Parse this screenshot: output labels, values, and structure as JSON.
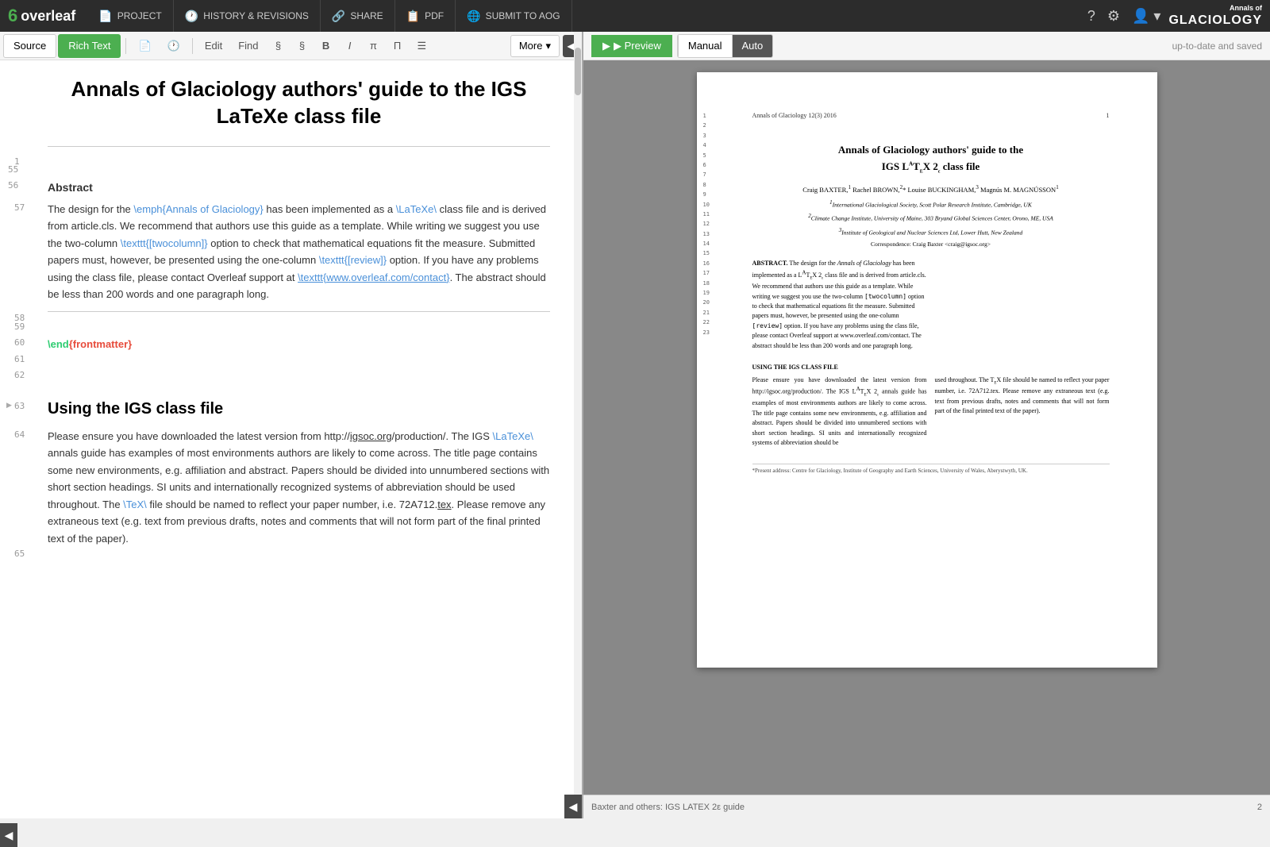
{
  "app": {
    "brand": "overleaf",
    "brand_icon": "6"
  },
  "top_nav": {
    "items": [
      {
        "id": "project",
        "icon": "📄",
        "label": "PROJECT"
      },
      {
        "id": "history",
        "icon": "🕐",
        "label": "HISTORY & REVISIONS"
      },
      {
        "id": "share",
        "icon": "🔗",
        "label": "SHARE"
      },
      {
        "id": "pdf",
        "icon": "📋",
        "label": "PDF"
      },
      {
        "id": "submit",
        "icon": "🌐",
        "label": "SUBMIT TO AOG"
      }
    ],
    "right_icons": [
      "?",
      "⚙",
      "👤"
    ],
    "journal_name": "GLACIOLOGY",
    "journal_prefix": "Annals of"
  },
  "editor_toolbar": {
    "source_tab": "Source",
    "rich_text_tab": "Rich Text",
    "buttons": [
      "📄",
      "🕐",
      "Edit",
      "Find",
      "§",
      "§",
      "B",
      "I",
      "π",
      "Π",
      "☰"
    ],
    "more_label": "More",
    "more_icon": "▾"
  },
  "preview_toolbar": {
    "run_label": "▶ Preview",
    "tabs": [
      "Manual",
      "Auto"
    ],
    "active_tab": "Manual",
    "status": "up-to-date and saved"
  },
  "editor": {
    "doc_title": "Annals of Glaciology authors' guide to the IGS LaTeXe class file",
    "line_numbers": [
      1,
      55,
      56,
      57,
      58,
      59,
      60,
      61,
      62,
      63,
      64,
      65
    ],
    "abstract_heading": "Abstract",
    "body_paragraph_1": "The design for the \\emph{Annals of Glaciology} has been implemented as a \\LaTeXe\\ class file and is derived from article.cls. We recommend that authors use this guide as a template. While writing we suggest you use the two-column \\texttt{[twocolumn]} option to check that mathematical equations fit the measure. Submitted papers must, however, be presented using the one-column \\texttt{[review]} option. If you have any problems using the class file, please contact Overleaf support at \\texttt{www.overleaf.com/contact}. The abstract should be less than 200 words and one paragraph long.",
    "end_frontmatter": "\\end{frontmatter}",
    "section_heading": "Using the IGS class file",
    "body_paragraph_2": "Please ensure you have downloaded the latest version from http://igsoc.org/production/. The IGS \\LaTeXe\\ annals guide has examples of most environments authors are likely to come across. The title page contains some new environments, e.g. affiliation and abstract. Papers should be divided into unnumbered sections with short section headings. SI units and internationally recognized systems of abbreviation should be used throughout. The \\TeX\\ file should be named to reflect your paper number, i.e. 72A712.tex. Please remove any extraneous text (e.g. text from previous drafts, notes and comments that will not form part of the final printed text of the paper)."
  },
  "pdf_preview": {
    "header_left": "Annals of Glaciology 12(3) 2016",
    "header_right": "1",
    "title_line1": "Annals of Glaciology authors' guide to the",
    "title_line2": "IGS LATEX 2ε class file",
    "authors": "Craig BAXTER,¹ Rachel BROWN,²* Louise BUCKINGHAM,³ Magnús M. MAGNÚSSON¹",
    "affiliations": [
      "¹International Glaciological Society, Scott Polar Research Institute, Cambridge, UK",
      "²Climate Change Institute, University of Maine, 303 Bryand Global Sciences Center, Orono, ME, USA",
      "³Institute of Geological and Nuclear Sciences Ltd, Lower Hutt, New Zealand"
    ],
    "correspondence": "Correspondence: Craig Baxter <craig@igsoc.org>",
    "abstract_head": "ABSTRACT.",
    "abstract_text": "The design for the Annals of Glaciology has been implemented as a LATEX 2ε class file and is derived from article.cls. We recommend that authors use this guide as a template. While writing we suggest you use the two-column [twocolumn] option to check that mathematical equations fit the measure. Submitted papers must, however, be presented using the one-column [review] option. If you have any problems using the class file, please contact Overleaf support at www.overleaf.com/contact. The abstract should be less than 200 words and one paragraph long.",
    "section_head": "USING THE IGS CLASS FILE",
    "section_text": "Please ensure you have downloaded the latest version from http://igsoc.org/production/. The IGS LATEX 2ε annals guide has examples of most environments authors are likely to come across. The title page contains some new environments, e.g. affiliation and abstract. Papers should be divided into unnumbered sections with short section headings. SI units and internationally recognized systems of abbreviation should be used throughout. The TEX file should be named to reflect your paper number, i.e. 72A712.tex. Please remove any extraneous text (e.g. text from previous drafts, notes and comments that will not form part of the final printed text of the paper).",
    "footnote": "*Present address: Centre for Glaciology, Institute of Geography and Earth Sciences, University of Wales, Aberystwyth, UK.",
    "footer_left": "Baxter and others: IGS LATEX 2ε guide",
    "footer_right": "2",
    "line_numbers": [
      1,
      2,
      3,
      4,
      5,
      6,
      7,
      8,
      9,
      10,
      11,
      12,
      13,
      14,
      15,
      16,
      17,
      18,
      19,
      20,
      21,
      22,
      23
    ]
  }
}
